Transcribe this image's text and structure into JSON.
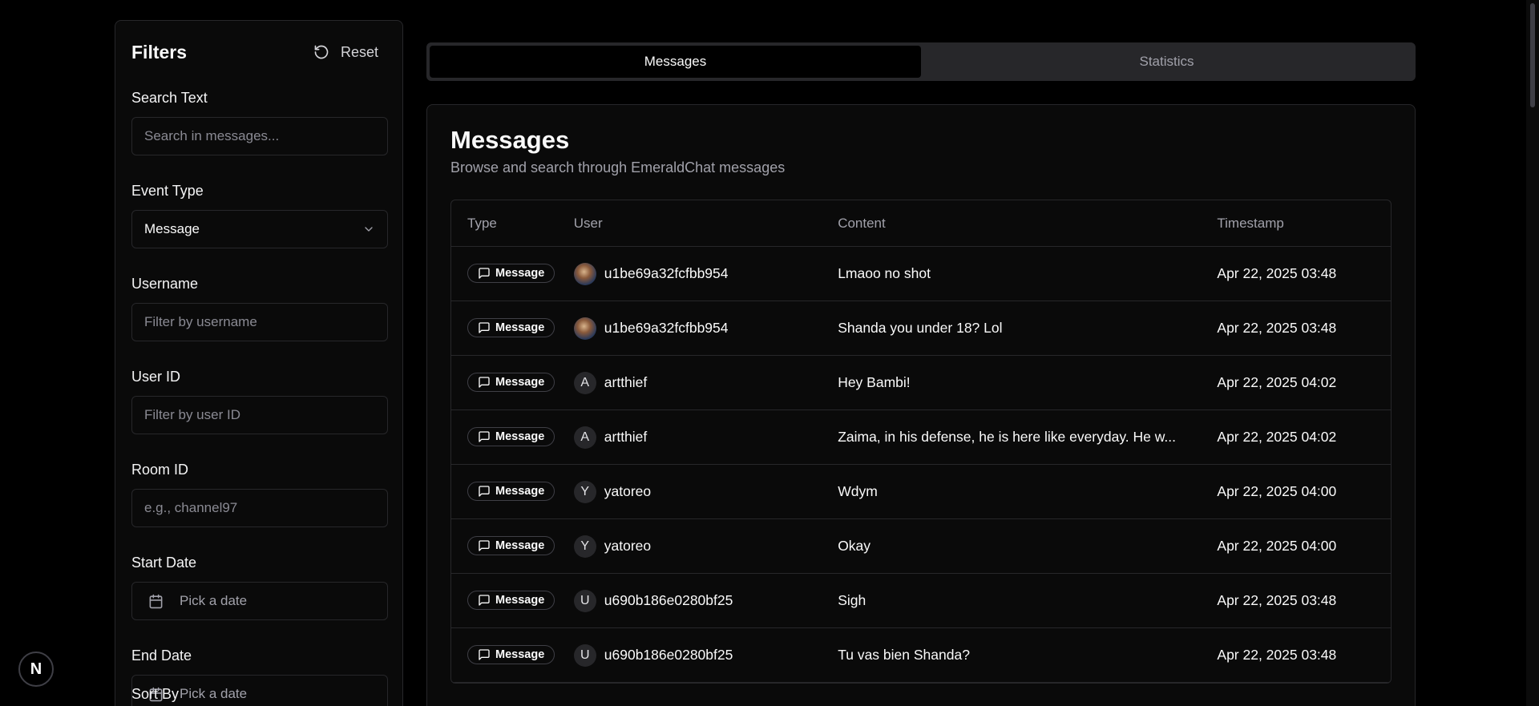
{
  "sidebar": {
    "title": "Filters",
    "reset_label": "Reset",
    "search": {
      "label": "Search Text",
      "placeholder": "Search in messages..."
    },
    "event_type": {
      "label": "Event Type",
      "value": "Message"
    },
    "username": {
      "label": "Username",
      "placeholder": "Filter by username"
    },
    "user_id": {
      "label": "User ID",
      "placeholder": "Filter by user ID"
    },
    "room_id": {
      "label": "Room ID",
      "placeholder": "e.g., channel97"
    },
    "start_date": {
      "label": "Start Date",
      "placeholder": "Pick a date"
    },
    "end_date": {
      "label": "End Date",
      "placeholder": "Pick a date"
    },
    "sort_by_label": "Sort By"
  },
  "tabs": [
    {
      "label": "Messages",
      "active": true
    },
    {
      "label": "Statistics",
      "active": false
    }
  ],
  "main": {
    "title": "Messages",
    "subtitle": "Browse and search through EmeraldChat messages",
    "columns": [
      "Type",
      "User",
      "Content",
      "Timestamp"
    ],
    "rows": [
      {
        "type": "Message",
        "avatar": "photo",
        "user": "u1be69a32fcfbb954",
        "content": "Lmaoo no shot",
        "timestamp": "Apr 22, 2025 03:48"
      },
      {
        "type": "Message",
        "avatar": "photo",
        "user": "u1be69a32fcfbb954",
        "content": "Shanda you under 18? Lol",
        "timestamp": "Apr 22, 2025 03:48"
      },
      {
        "type": "Message",
        "avatar": "A",
        "user": "artthief",
        "content": "Hey Bambi!",
        "timestamp": "Apr 22, 2025 04:02"
      },
      {
        "type": "Message",
        "avatar": "A",
        "user": "artthief",
        "content": "Zaima, in his defense, he is here like everyday. He w...",
        "timestamp": "Apr 22, 2025 04:02"
      },
      {
        "type": "Message",
        "avatar": "Y",
        "user": "yatoreo",
        "content": "Wdym",
        "timestamp": "Apr 22, 2025 04:00"
      },
      {
        "type": "Message",
        "avatar": "Y",
        "user": "yatoreo",
        "content": "Okay",
        "timestamp": "Apr 22, 2025 04:00"
      },
      {
        "type": "Message",
        "avatar": "U",
        "user": "u690b186e0280bf25",
        "content": "Sigh",
        "timestamp": "Apr 22, 2025 03:48"
      },
      {
        "type": "Message",
        "avatar": "U",
        "user": "u690b186e0280bf25",
        "content": "Tu vas bien Shanda?",
        "timestamp": "Apr 22, 2025 03:48"
      }
    ]
  },
  "next_badge": "N"
}
